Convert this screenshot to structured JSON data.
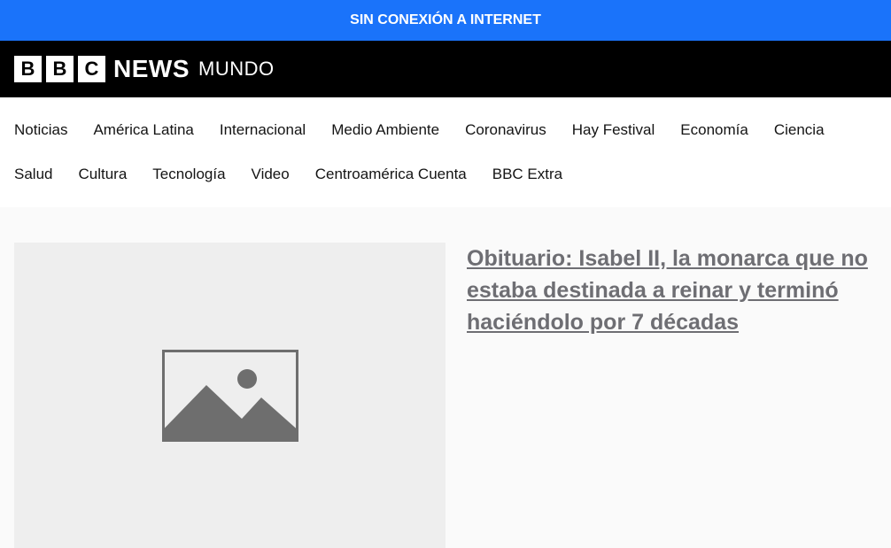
{
  "banner": {
    "text": "SIN CONEXIÓN A INTERNET"
  },
  "brand": {
    "blocks": [
      "B",
      "B",
      "C"
    ],
    "news": "NEWS",
    "service": "MUNDO"
  },
  "nav": {
    "row1": [
      "Noticias",
      "América Latina",
      "Internacional",
      "Medio Ambiente",
      "Coronavirus",
      "Hay Festival",
      "Economía",
      "Ciencia"
    ],
    "row2": [
      "Salud",
      "Cultura",
      "Tecnología",
      "Video",
      "Centroamérica Cuenta",
      "BBC Extra"
    ]
  },
  "promo": {
    "headline": "Obituario: Isabel II, la monarca que no estaba destinada a reinar y terminó haciéndolo por 7 décadas",
    "image_icon": "image-placeholder-icon"
  },
  "colors": {
    "banner": "#1a73fa",
    "masthead": "#000000",
    "headline": "#6e6e73",
    "image_bg": "#eeeeee",
    "icon": "#6e6e6e"
  }
}
